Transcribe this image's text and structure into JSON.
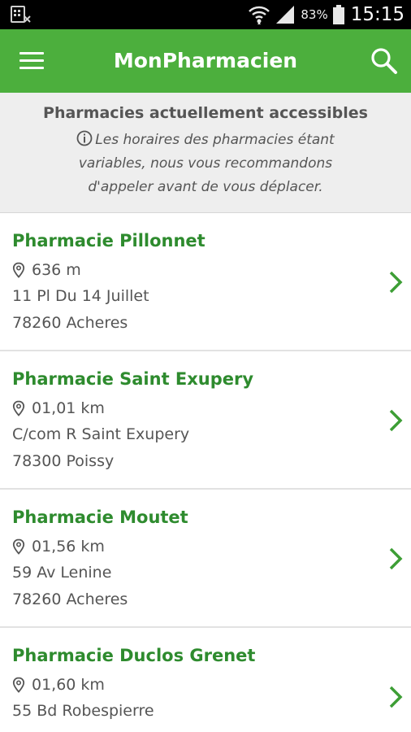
{
  "status_bar": {
    "battery_percent": "83%",
    "time": "15:15",
    "icons": [
      "sim-icon",
      "wifi-icon",
      "signal-icon",
      "battery-icon"
    ]
  },
  "app_bar": {
    "title": "MonPharmacien",
    "menu_icon": "menu-icon",
    "search_icon": "search-icon",
    "color": "#4caf3d"
  },
  "notice": {
    "title": "Pharmacies actuellement accessibles",
    "text": "Les horaires des pharmacies étant variables, nous vous recommandons d'appeler avant de vous déplacer."
  },
  "pharmacies": [
    {
      "name": "Pharmacie Pillonnet",
      "distance": "636 m",
      "address": "11 Pl Du 14 Juillet",
      "city": "78260 Acheres"
    },
    {
      "name": "Pharmacie Saint Exupery",
      "distance": "01,01 km",
      "address": "C/com R Saint Exupery",
      "city": "78300 Poissy"
    },
    {
      "name": "Pharmacie Moutet",
      "distance": "01,56 km",
      "address": "59 Av Lenine",
      "city": "78260 Acheres"
    },
    {
      "name": "Pharmacie Duclos Grenet",
      "distance": "01,60 km",
      "address": "55 Bd Robespierre",
      "city": ""
    }
  ],
  "accent_colors": {
    "name_green": "#2e8b2e",
    "chevron_green": "#3d9e35"
  }
}
